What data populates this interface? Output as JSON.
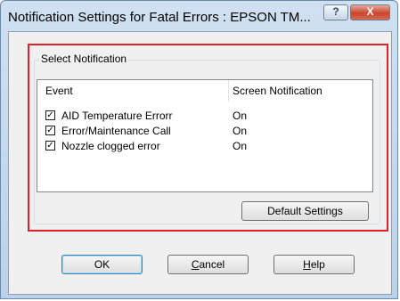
{
  "window": {
    "title": "Notification Settings for Fatal Errors : EPSON TM...",
    "help_glyph": "?",
    "close_glyph": "X"
  },
  "group": {
    "label": "Select Notification"
  },
  "list": {
    "columns": [
      "Event",
      "Screen Notification"
    ],
    "rows": [
      {
        "checked": true,
        "event": "AID Temperature Errorr",
        "notification": "On"
      },
      {
        "checked": true,
        "event": "Error/Maintenance Call",
        "notification": "On"
      },
      {
        "checked": true,
        "event": "Nozzle clogged error",
        "notification": "On"
      }
    ]
  },
  "buttons": {
    "default_settings": "Default Settings",
    "ok": "OK",
    "cancel_mnemonic": "C",
    "cancel_rest": "ancel",
    "help_mnemonic": "H",
    "help_rest": "elp"
  },
  "colors": {
    "highlight_border": "#e0202a",
    "titlebar": "#bcd2ea",
    "close_button": "#c8452d"
  }
}
